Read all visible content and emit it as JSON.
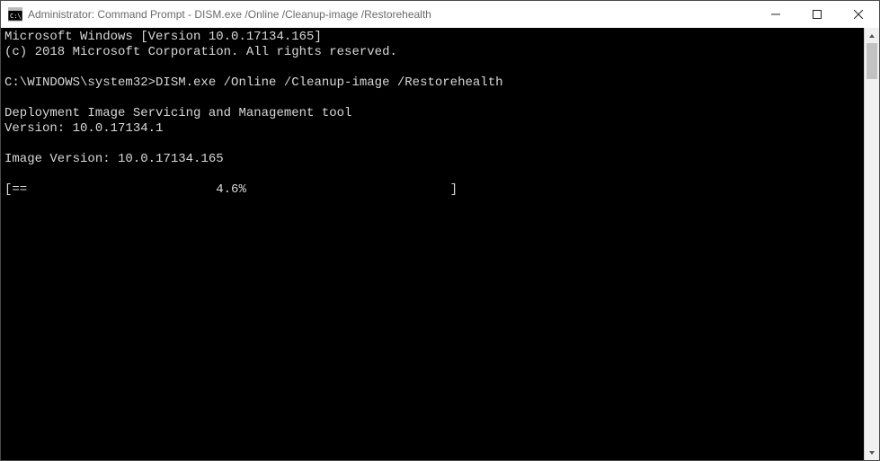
{
  "window": {
    "title": "Administrator: Command Prompt - DISM.exe  /Online /Cleanup-image /Restorehealth"
  },
  "console": {
    "lines": [
      "Microsoft Windows [Version 10.0.17134.165]",
      "(c) 2018 Microsoft Corporation. All rights reserved.",
      "",
      "C:\\WINDOWS\\system32>DISM.exe /Online /Cleanup-image /Restorehealth",
      "",
      "Deployment Image Servicing and Management tool",
      "Version: 10.0.17134.1",
      "",
      "Image Version: 10.0.17134.165",
      "",
      "[==                         4.6%                           ]"
    ]
  }
}
